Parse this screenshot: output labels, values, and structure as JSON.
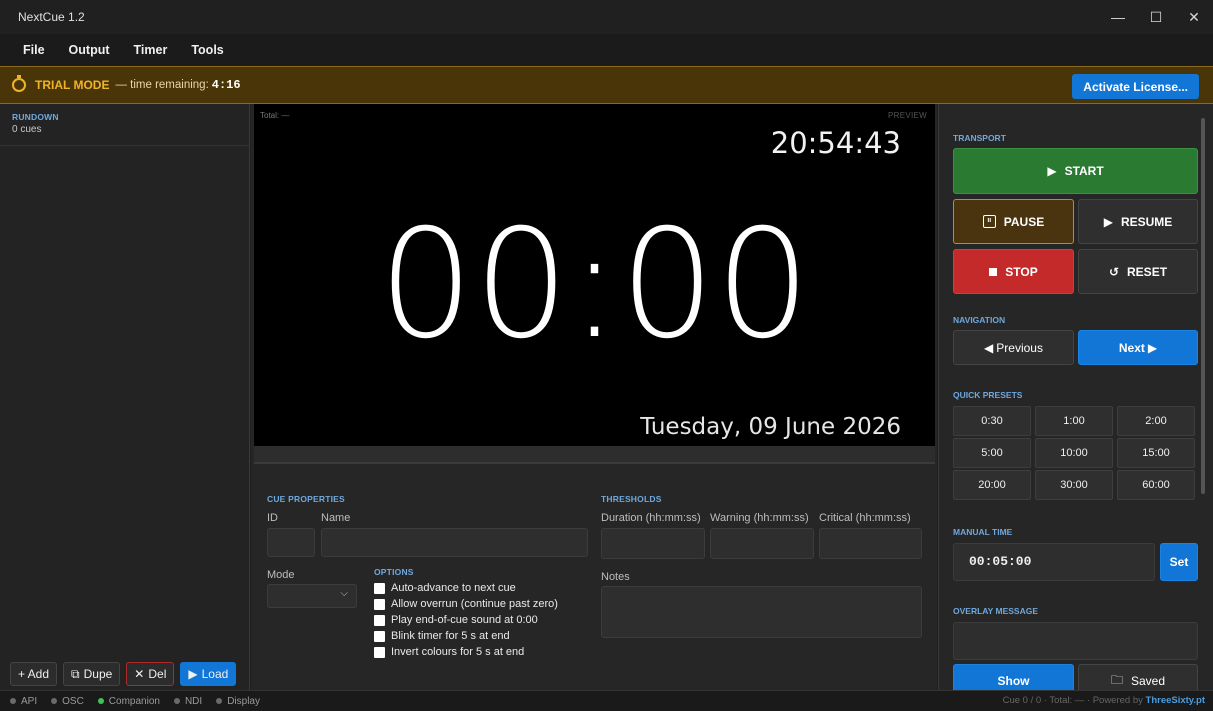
{
  "window": {
    "title": "NextCue 1.2",
    "controls": [
      "—",
      "☐",
      "✕"
    ]
  },
  "menu": [
    "File",
    "Output",
    "Timer",
    "Tools"
  ],
  "trial": {
    "label": "TRIAL MODE",
    "text": "— time remaining:",
    "time": "4:16",
    "activate": "Activate License..."
  },
  "rundown": {
    "title": "RUNDOWN",
    "count": "0 cues",
    "actions": {
      "add": "+ Add",
      "dupe": "Dupe",
      "del": "Del",
      "load": "Load"
    }
  },
  "preview": {
    "total": "Total: —",
    "tag": "PREVIEW",
    "clock": "20:54:43",
    "timer": "00:00",
    "date": "Tuesday, 09 June 2026"
  },
  "cue": {
    "title": "CUE PROPERTIES",
    "id_label": "ID",
    "name_label": "Name",
    "mode_label": "Mode",
    "options_title": "OPTIONS",
    "options": [
      "Auto-advance to next cue",
      "Allow overrun (continue past zero)",
      "Play end-of-cue sound at 0:00",
      "Blink timer for 5 s at end",
      "Invert colours for 5 s at end"
    ],
    "thresholds_title": "THRESHOLDS",
    "duration_label": "Duration (hh:mm:ss)",
    "warning_label": "Warning (hh:mm:ss)",
    "critical_label": "Critical (hh:mm:ss)",
    "notes_label": "Notes"
  },
  "transport": {
    "title": "TRANSPORT",
    "start": "START",
    "pause": "PAUSE",
    "resume": "RESUME",
    "stop": "STOP",
    "reset": "RESET"
  },
  "navigation": {
    "title": "NAVIGATION",
    "previous": "Previous",
    "next": "Next"
  },
  "presets": {
    "title": "QUICK PRESETS",
    "items": [
      "0:30",
      "1:00",
      "2:00",
      "5:00",
      "10:00",
      "15:00",
      "20:00",
      "30:00",
      "60:00"
    ]
  },
  "manual": {
    "title": "MANUAL TIME",
    "value": "00:05:00",
    "set": "Set"
  },
  "overlay": {
    "title": "OVERLAY MESSAGE",
    "show": "Show",
    "saved": "Saved"
  },
  "status": {
    "items": [
      {
        "label": "API",
        "on": false
      },
      {
        "label": "OSC",
        "on": false
      },
      {
        "label": "Companion",
        "on": true
      },
      {
        "label": "NDI",
        "on": false
      },
      {
        "label": "Display",
        "on": false
      }
    ],
    "right": "Cue 0 / 0 · Total: — · Powered by",
    "brand": "ThreeSixty.pt"
  },
  "colors": {
    "accent": "#1176d6",
    "start": "#2a7a31",
    "stop": "#c42a2a",
    "trial": "#f0b429",
    "status_on": "#3cc45a"
  }
}
